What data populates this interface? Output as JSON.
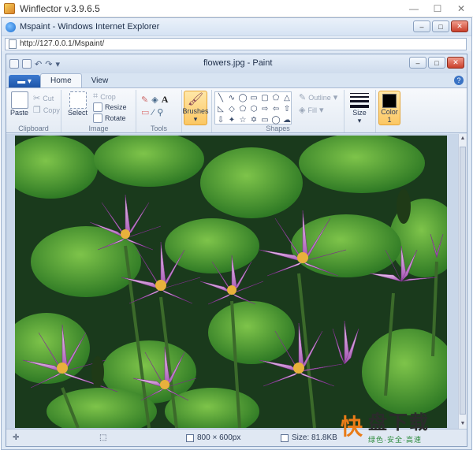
{
  "outer_window": {
    "title": "Winflector v.3.9.6.5"
  },
  "ie": {
    "title": "Mspaint - Windows Internet Explorer",
    "url": "http://127.0.0.1/Mspaint/"
  },
  "paint": {
    "title": "flowers.jpg - Paint",
    "tabs": [
      {
        "label": "Home"
      },
      {
        "label": "View"
      }
    ],
    "clipboard": {
      "paste": "Paste",
      "cut": "Cut",
      "copy": "Copy",
      "label": "Clipboard"
    },
    "image": {
      "select": "Select",
      "crop": "Crop",
      "resize": "Resize",
      "rotate": "Rotate",
      "label": "Image"
    },
    "tools": {
      "label": "Tools"
    },
    "brushes": {
      "label": "Brushes"
    },
    "shapes": {
      "outline": "Outline",
      "fill": "Fill",
      "label": "Shapes"
    },
    "size": {
      "label": "Size"
    },
    "color": {
      "label": "Color",
      "number": "1"
    },
    "status": {
      "dimensions": "800 × 600px",
      "size": "Size: 81.8KB"
    }
  },
  "watermark": {
    "brand": "盘下载",
    "slogan": "绿色·安全·高速",
    "logo_char": "快"
  },
  "colors": {
    "accent": "#fbc764",
    "ribbon_tab": "#1e55a8"
  }
}
